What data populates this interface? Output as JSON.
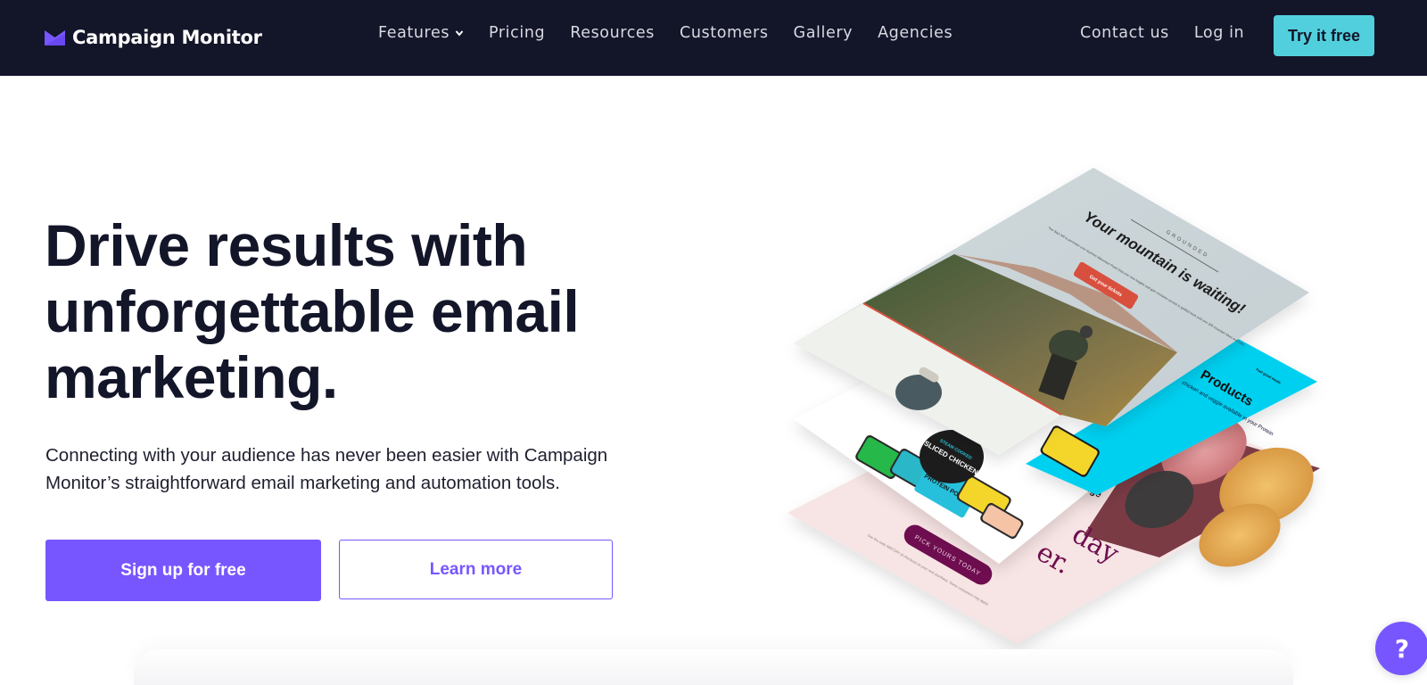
{
  "brand": {
    "name": "Campaign Monitor",
    "logo_icon": "envelope-icon",
    "accent_color": "#7856ff",
    "nav_bg_color": "#131529",
    "cta_color": "#52cfdd"
  },
  "nav": {
    "items": [
      {
        "label": "Features",
        "has_dropdown": true
      },
      {
        "label": "Pricing"
      },
      {
        "label": "Resources"
      },
      {
        "label": "Customers"
      },
      {
        "label": "Gallery"
      },
      {
        "label": "Agencies"
      }
    ],
    "right_items": [
      {
        "label": "Contact us"
      },
      {
        "label": "Log in"
      }
    ],
    "cta_label": "Try it free"
  },
  "hero": {
    "title": "Drive results with unforgettable email marketing.",
    "subtitle": "Connecting with your audience has never been easier with Campaign Monitor’s straightforward email marketing and automation tools.",
    "primary_button": "Sign up for free",
    "secondary_button": "Learn more"
  },
  "illustration": {
    "top_email": {
      "brand": "GROUNDED",
      "headline": "Your mountain is waiting!",
      "body": "Two days left to purchase your Summer Adventure Pass! Discover new heights and gain exclusive access to guided tours and over 300 mountain hikes and trails.",
      "button": "Get your tickets",
      "colors": {
        "bg": "#cdd6d9",
        "button": "#d94f3d"
      }
    },
    "cyan_email": {
      "tagline": "Feel good meals",
      "headline": "Products",
      "body": "chicken and veggie available in your Protein",
      "color": "#00d0f0"
    },
    "middle_email": {
      "badge_top": "STEAM COOKED",
      "badge_main": "SLICED CHICKEN",
      "product": "PROTEIN POUCH",
      "caption": "Pouch range"
    },
    "bottom_email": {
      "headline_fragment_1": "day",
      "headline_fragment_2": "er.",
      "button": "PICK YOURS TODAY",
      "fineprint": "Use the code MACDAY at checkout on your next purchase. Some exclusions may apply.",
      "colors": {
        "bg": "#f7e4e4",
        "button": "#6e1150"
      }
    }
  },
  "help": {
    "label": "?",
    "icon": "help-icon"
  }
}
